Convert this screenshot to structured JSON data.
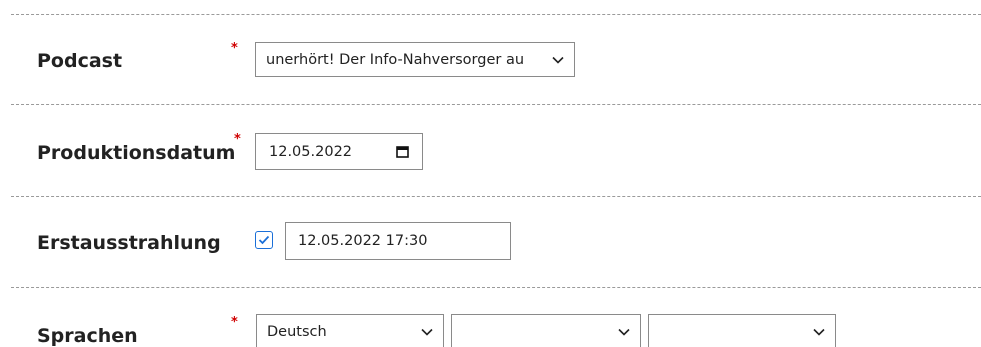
{
  "form": {
    "podcast": {
      "label": "Podcast",
      "required_mark": "*",
      "selected": "unerhört! Der Info-Nahversorger au"
    },
    "produktionsdatum": {
      "label": "Produktionsdatum",
      "required_mark": "*",
      "value": "12.05.2022"
    },
    "erstausstrahlung": {
      "label": "Erstausstrahlung",
      "checked": true,
      "value": "12.05.2022 17:30"
    },
    "sprachen": {
      "label": "Sprachen",
      "required_mark": "*",
      "selects": [
        {
          "selected": "Deutsch"
        },
        {
          "selected": ""
        },
        {
          "selected": ""
        }
      ]
    }
  },
  "colors": {
    "required": "#d00000",
    "checkbox_accent": "#1a6fd8",
    "border": "#8a8a8a",
    "divider": "#9a9a9a"
  },
  "icons": {
    "select_arrow": "chevron-down-icon",
    "date_picker": "calendar-icon",
    "checkbox_mark": "checkmark-icon"
  }
}
